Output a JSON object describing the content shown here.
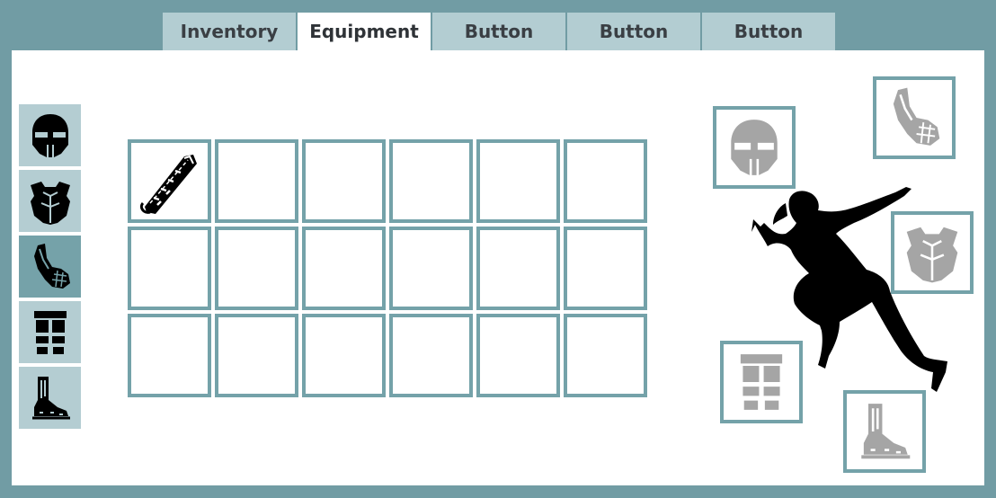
{
  "tabs": [
    {
      "label": "Inventory",
      "active": false
    },
    {
      "label": "Equipment",
      "active": true
    },
    {
      "label": "Button",
      "active": false
    },
    {
      "label": "Button",
      "active": false
    },
    {
      "label": "Button",
      "active": false
    }
  ],
  "sidebar": {
    "items": [
      {
        "icon": "helmet-icon",
        "selected": false
      },
      {
        "icon": "chest-armor-icon",
        "selected": false
      },
      {
        "icon": "gauntlet-icon",
        "selected": true
      },
      {
        "icon": "leg-armor-icon",
        "selected": false
      },
      {
        "icon": "boot-icon",
        "selected": false
      }
    ]
  },
  "inventory_grid": {
    "rows": 3,
    "columns": 6,
    "items": [
      {
        "slot": 0,
        "icon": "bracer-icon"
      }
    ]
  },
  "equipment_slots": {
    "head": {
      "icon": "helmet-icon"
    },
    "hands": {
      "icon": "gauntlet-icon"
    },
    "chest": {
      "icon": "chest-armor-icon"
    },
    "legs": {
      "icon": "leg-armor-icon"
    },
    "feet": {
      "icon": "boot-icon"
    }
  },
  "colors": {
    "frame": "#719ca4",
    "tab_inactive": "#b3cdd2",
    "slot_border": "#74a2a9",
    "sidebar_selected": "#75a2a9",
    "equipped_icon": "#a5a5a5"
  }
}
